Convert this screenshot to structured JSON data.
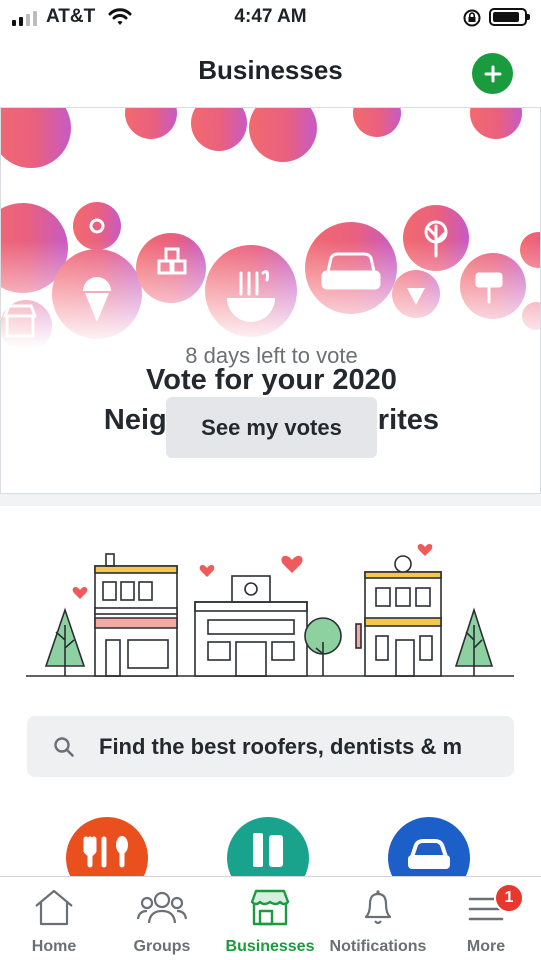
{
  "status_bar": {
    "carrier": "AT&T",
    "time": "4:47 AM"
  },
  "header": {
    "title": "Businesses"
  },
  "vote_card": {
    "title_line1": "Vote for your 2020",
    "title_line2": "Neighborhood Favorites",
    "subtitle": "8 days left to vote",
    "button_label": "See my votes"
  },
  "search": {
    "placeholder": "Find the best roofers, dentists & m"
  },
  "tabs": [
    {
      "label": "Home",
      "icon": "home-icon"
    },
    {
      "label": "Groups",
      "icon": "groups-icon"
    },
    {
      "label": "Businesses",
      "icon": "storefront-icon",
      "active": true
    },
    {
      "label": "Notifications",
      "icon": "bell-icon"
    },
    {
      "label": "More",
      "icon": "menu-icon",
      "badge": "1"
    }
  ],
  "colors": {
    "brand_green": "#1a9c3e",
    "badge_red": "#e8372d",
    "restaurants": "#ea4f1e",
    "health": "#1aa38c",
    "auto": "#1c5fc9"
  }
}
